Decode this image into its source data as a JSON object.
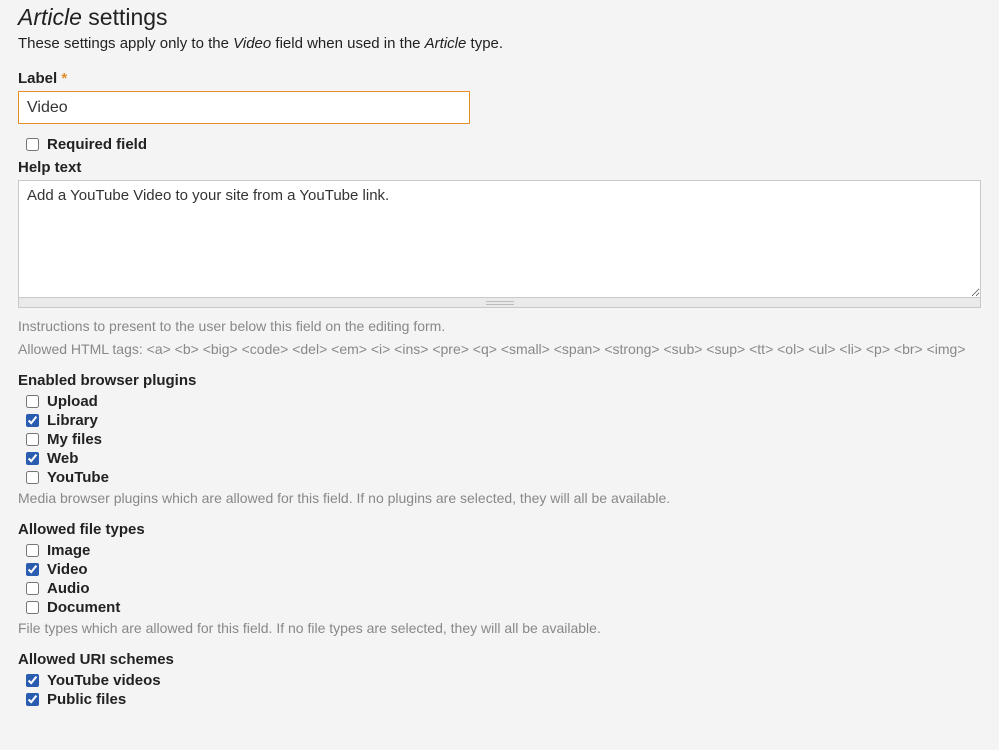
{
  "title_prefix": "Article",
  "title_suffix": " settings",
  "subtitle_parts": [
    "These settings apply only to the ",
    "Video",
    " field when used in the ",
    "Article",
    " type."
  ],
  "label": {
    "text": "Label",
    "marker": "*",
    "value": "Video"
  },
  "required_field": {
    "label": "Required field",
    "checked": false
  },
  "help_text": {
    "label": "Help text",
    "value": "Add a YouTube Video to your site from a YouTube link.",
    "desc1": "Instructions to present to the user below this field on the editing form.",
    "desc2": "Allowed HTML tags: <a> <b> <big> <code> <del> <em> <i> <ins> <pre> <q> <small> <span> <strong> <sub> <sup> <tt> <ol> <ul> <li> <p> <br> <img>"
  },
  "plugins": {
    "heading": "Enabled browser plugins",
    "items": [
      {
        "label": "Upload",
        "checked": false
      },
      {
        "label": "Library",
        "checked": true
      },
      {
        "label": "My files",
        "checked": false
      },
      {
        "label": "Web",
        "checked": true
      },
      {
        "label": "YouTube",
        "checked": false
      }
    ],
    "desc": "Media browser plugins which are allowed for this field. If no plugins are selected, they will all be available."
  },
  "filetypes": {
    "heading": "Allowed file types",
    "items": [
      {
        "label": "Image",
        "checked": false
      },
      {
        "label": "Video",
        "checked": true
      },
      {
        "label": "Audio",
        "checked": false
      },
      {
        "label": "Document",
        "checked": false
      }
    ],
    "desc": "File types which are allowed for this field. If no file types are selected, they will all be available."
  },
  "uri": {
    "heading": "Allowed URI schemes",
    "items": [
      {
        "label": "YouTube videos",
        "checked": true
      },
      {
        "label": "Public files",
        "checked": true
      }
    ]
  }
}
